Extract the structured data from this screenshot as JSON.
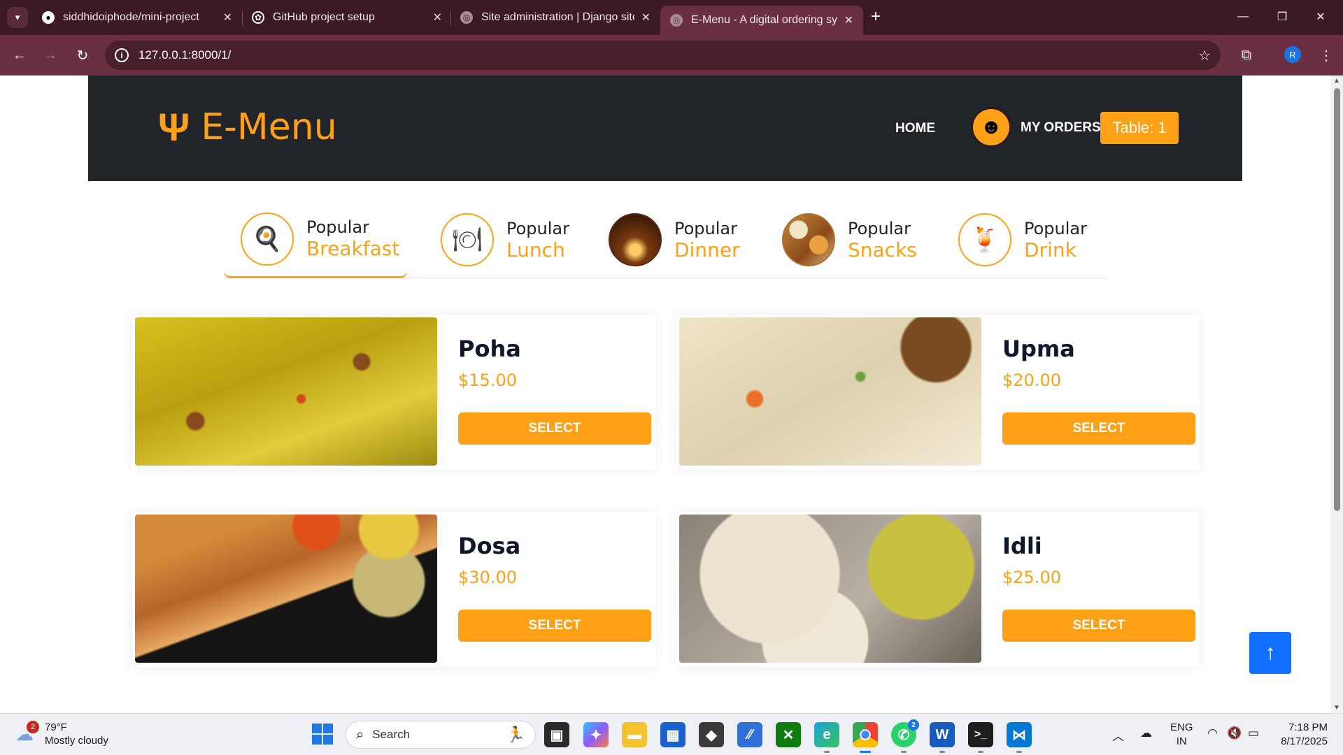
{
  "browser": {
    "tabs": [
      {
        "title": "siddhidoiphode/mini-project",
        "icon": "github-icon"
      },
      {
        "title": "GitHub project setup",
        "icon": "openai-icon"
      },
      {
        "title": "Site administration | Django site",
        "icon": "globe-icon"
      },
      {
        "title": "E-Menu - A digital ordering sys",
        "icon": "globe-icon",
        "active": true
      }
    ],
    "url": "127.0.0.1:8000/1/",
    "profile_initial": "R"
  },
  "header": {
    "brand": "E-Menu",
    "nav_home": "HOME",
    "nav_orders": "MY ORDERS",
    "table_label": "Table: 1"
  },
  "categories": [
    {
      "small": "Popular",
      "big": "Breakfast",
      "icon": "breakfast-icon",
      "active": true
    },
    {
      "small": "Popular",
      "big": "Lunch",
      "icon": "plate-fork-knife-icon"
    },
    {
      "small": "Popular",
      "big": "Dinner",
      "icon": "dinner-photo"
    },
    {
      "small": "Popular",
      "big": "Snacks",
      "icon": "snacks-photo"
    },
    {
      "small": "Popular",
      "big": "Drink",
      "icon": "drink-icon"
    }
  ],
  "items": [
    {
      "name": "Poha",
      "price": "$15.00",
      "button": "SELECT"
    },
    {
      "name": "Upma",
      "price": "$20.00",
      "button": "SELECT"
    },
    {
      "name": "Dosa",
      "price": "$30.00",
      "button": "SELECT"
    },
    {
      "name": "Idli",
      "price": "$25.00",
      "button": "SELECT"
    }
  ],
  "taskbar": {
    "weather_temp": "79°F",
    "weather_desc": "Mostly cloudy",
    "weather_badge": "2",
    "search_placeholder": "Search",
    "whatsapp_badge": "2",
    "lang_line1": "ENG",
    "lang_line2": "IN",
    "time": "7:18 PM",
    "date": "8/17/2025"
  },
  "colors": {
    "accent": "#fea116",
    "header_bg": "#212529",
    "tabbar_bg": "#3c1a25",
    "toolbar_bg": "#6a2f40",
    "to_top": "#1170ff"
  }
}
